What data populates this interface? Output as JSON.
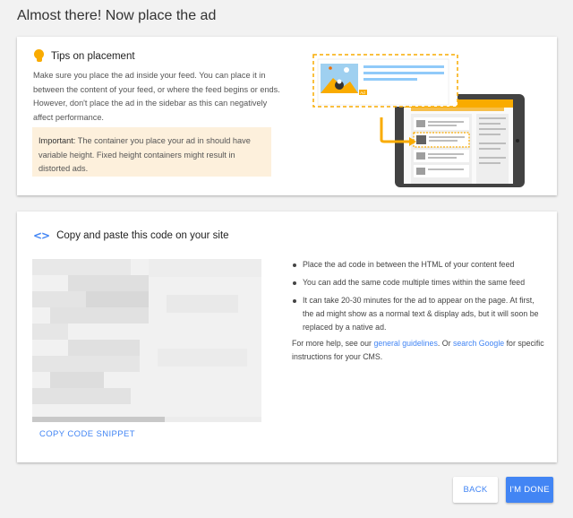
{
  "page": {
    "title": "Almost there! Now place the ad"
  },
  "tips": {
    "title": "Tips on placement",
    "body": "Make sure you place the ad inside your feed. You can place it in between the content of your feed, or where the feed begins or ends. However, don't place the ad in the sidebar as this can negatively affect performance.",
    "important_label": "Important:",
    "important_text": " The container you place your ad in should have variable height. Fixed height containers might result in distorted ads."
  },
  "illustration": {
    "ad_badge": "Ad"
  },
  "code": {
    "title": "Copy and paste this code on your site",
    "copy_label": "COPY CODE SNIPPET",
    "bullets": [
      "Place the ad code in between the HTML of your content feed",
      "You can add the same code multiple times within the same feed",
      "It can take 20-30 minutes for the ad to appear on the page. At first, the ad might show as a normal text & display ads, but it will soon be replaced by a native ad."
    ],
    "help_prefix": "For more help, see our ",
    "help_link1": "general guidelines",
    "help_mid": ". Or ",
    "help_link2": "search Google",
    "help_suffix": " for specific instructions for your CMS."
  },
  "buttons": {
    "back": "BACK",
    "done": "I'M DONE"
  },
  "colors": {
    "accent": "#4285f4",
    "warning_bg": "#fdf0dc",
    "bulb": "#f9ab00",
    "illustration_orange": "#f9ab00"
  }
}
